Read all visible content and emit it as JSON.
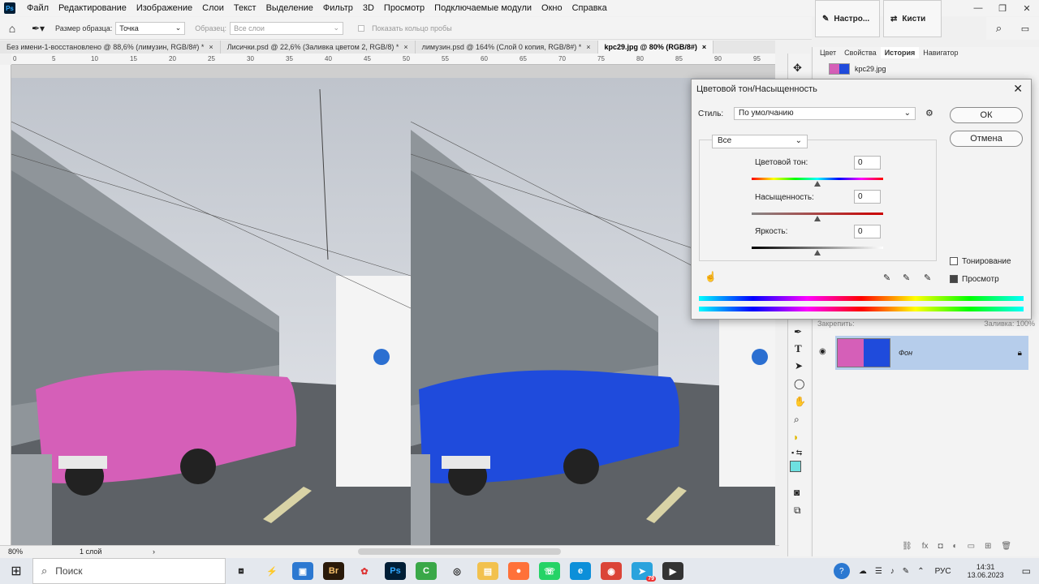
{
  "app": {
    "logo_text": "Ps"
  },
  "menu": [
    "Файл",
    "Редактирование",
    "Изображение",
    "Слои",
    "Текст",
    "Выделение",
    "Фильтр",
    "3D",
    "Просмотр",
    "Подключаемые модули",
    "Окно",
    "Справка"
  ],
  "options": {
    "sample_size_label": "Размер образца:",
    "sample_size_value": "Точка",
    "sample_label": "Образец:",
    "sample_value": "Все слои",
    "ring_label": "Показать кольцо пробы"
  },
  "float_panels": {
    "adjust": "Настро...",
    "brushes": "Кисти"
  },
  "tabs": [
    {
      "label": "Без имени-1-восстановлено @ 88,6% (лимузин, RGB/8#) *",
      "active": false
    },
    {
      "label": "Лисички.psd @ 22,6% (Заливка цветом 2, RGB/8) *",
      "active": false
    },
    {
      "label": "лимузин.psd @ 164% (Слой 0 копия, RGB/8#) *",
      "active": false
    },
    {
      "label": "kpc29.jpg @ 80% (RGB/8#)",
      "active": true
    }
  ],
  "ruler_h": [
    "0",
    "5",
    "10",
    "15",
    "20",
    "25",
    "30",
    "35",
    "40",
    "45",
    "50",
    "55",
    "60",
    "65",
    "70",
    "75",
    "80",
    "85",
    "90",
    "95"
  ],
  "status": {
    "zoom": "80%",
    "info": "1 слой"
  },
  "panels": {
    "tabs": [
      "Цвет",
      "Свойства",
      "История",
      "Навигатор"
    ],
    "active_tab": "История",
    "history_item": "kpc29.jpg",
    "lock_label": "Закрепить:",
    "fill_label": "Заливка:",
    "fill_value": "100%",
    "layer_name": "Фон"
  },
  "dialog": {
    "title": "Цветовой тон/Насыщенность",
    "style_label": "Стиль:",
    "style_value": "По умолчанию",
    "ok": "ОК",
    "cancel": "Отмена",
    "channel": "Все",
    "hue_label": "Цветовой тон:",
    "hue_value": "0",
    "sat_label": "Насыщенность:",
    "sat_value": "0",
    "light_label": "Яркость:",
    "light_value": "0",
    "colorize_label": "Тонирование",
    "colorize_checked": false,
    "preview_label": "Просмотр",
    "preview_checked": true
  },
  "taskbar": {
    "search_placeholder": "Поиск",
    "lang": "РУС",
    "time": "14:31",
    "date": "13.06.2023",
    "notif_count": "79"
  },
  "colors": {
    "limo_left": "#d55fb8",
    "limo_right": "#1f4bdc",
    "layer_selected": "#b6cdeb",
    "accent": "#31a8ff"
  }
}
